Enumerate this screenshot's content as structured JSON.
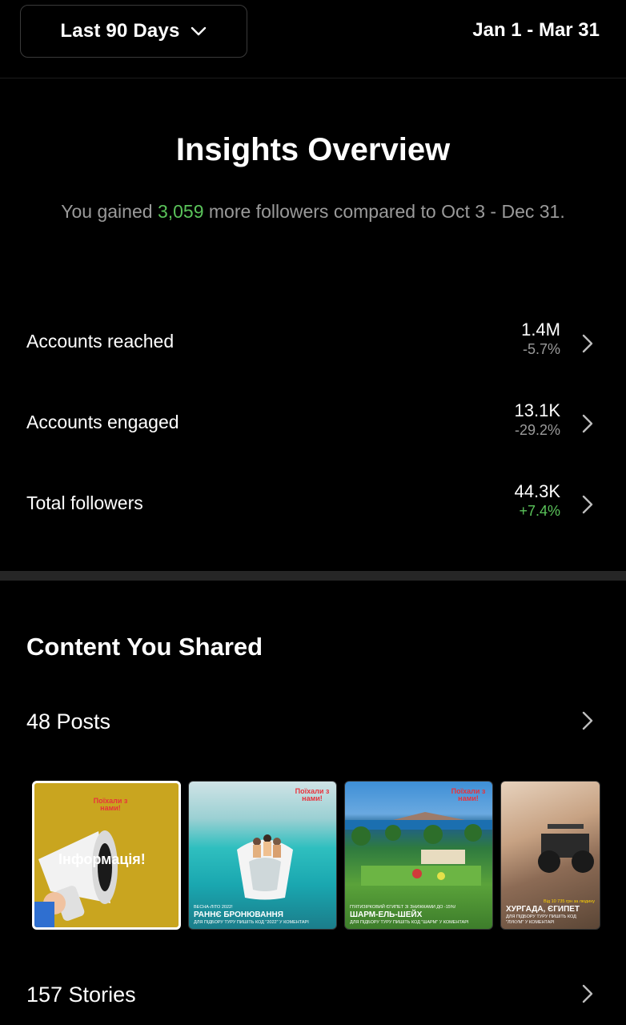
{
  "header": {
    "range_label": "Last 90 Days",
    "date_range": "Jan 1 - Mar 31"
  },
  "overview": {
    "title": "Insights Overview",
    "subtitle_pre": "You gained ",
    "gained": "3,059",
    "subtitle_post": " more followers compared to Oct 3 - Dec 31.",
    "metrics": [
      {
        "name": "Accounts reached",
        "value": "1.4M",
        "change": "-5.7%"
      },
      {
        "name": "Accounts engaged",
        "value": "13.1K",
        "change": "-29.2%"
      },
      {
        "name": "Total followers",
        "value": "44.3K",
        "change": "+7.4%"
      }
    ]
  },
  "content": {
    "title": "Content You Shared",
    "posts_label": "48 Posts",
    "stories_label": "157 Stories",
    "thumbnails": [
      {
        "logo": "Поїхали з нами!",
        "text": "Інформація!"
      },
      {
        "logo": "Поїхали з нами!",
        "small": "ВЕСНА-ЛІТО 2022!",
        "big": "РАННЄ БРОНЮВАННЯ",
        "note": "ДЛЯ ПІДБОРУ ТУРУ ПИШІТЬ КОД \"2022\" У КОМЕНТАРІ"
      },
      {
        "logo": "Поїхали з нами!",
        "small": "П'ЯТИЗІРКОВИЙ ЄГИПЕТ ЗІ ЗНИЖКАМИ ДО -15%!",
        "big": "ШАРМ-ЕЛЬ-ШЕЙХ",
        "note": "ДЛЯ ПІДБОРУ ТУРУ ПИШІТЬ КОД \"ШАРМ\" У КОМЕНТАРІ"
      },
      {
        "small": "Від 10 735 грн за людину",
        "big": "ХУРГАДА, ЄГИПЕТ",
        "note": "ДЛЯ ПІДБОРУ ТУРУ ПИШІТЬ КОД \"ЛУКУМ\" У КОМЕНТАРІ"
      }
    ]
  },
  "colors": {
    "positive": "#5ac35a",
    "muted": "#9a9a9a",
    "background": "#000000"
  }
}
